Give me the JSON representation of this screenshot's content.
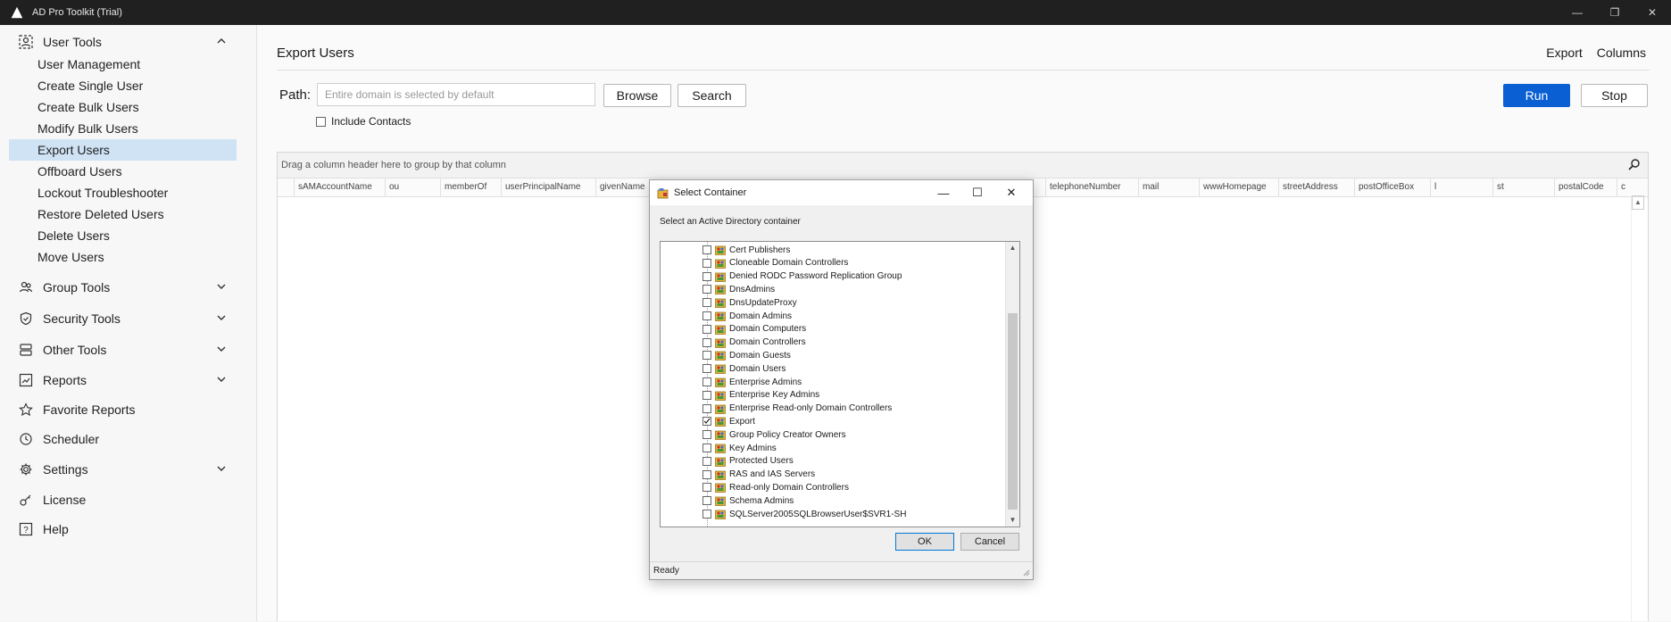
{
  "window": {
    "title": "AD Pro Toolkit (Trial)",
    "controls": [
      "—",
      "❐",
      "✕"
    ]
  },
  "sidebar": {
    "user_tools": {
      "label": "User Tools",
      "items": [
        "User Management",
        "Create Single User",
        "Create Bulk Users",
        "Modify Bulk Users",
        "Export Users",
        "Offboard Users",
        "Lockout Troubleshooter",
        "Restore Deleted Users",
        "Delete Users",
        "Move Users"
      ],
      "selected": "Export Users"
    },
    "group_tools": "Group Tools",
    "security_tools": "Security Tools",
    "other_tools": "Other Tools",
    "reports": "Reports",
    "favorite_reports": "Favorite Reports",
    "scheduler": "Scheduler",
    "settings": "Settings",
    "license": "License",
    "help": "Help"
  },
  "main": {
    "title": "Export Users",
    "export_link": "Export",
    "columns_link": "Columns",
    "path_label": "Path:",
    "path_placeholder": "Entire domain is selected by default",
    "browse": "Browse",
    "search": "Search",
    "run": "Run",
    "stop": "Stop",
    "include_contacts": "Include Contacts",
    "group_hint": "Drag a column header here to group by that column",
    "columns": [
      "sAMAccountName",
      "ou",
      "memberOf",
      "userPrincipalName",
      "givenName",
      "telephoneNumber",
      "mail",
      "wwwHomepage",
      "streetAddress",
      "postOfficeBox",
      "l",
      "st",
      "postalCode",
      "c"
    ]
  },
  "dialog": {
    "title": "Select Container",
    "subtitle": "Select an Active Directory container",
    "items": [
      "Cert Publishers",
      "Cloneable Domain Controllers",
      "Denied RODC Password Replication Group",
      "DnsAdmins",
      "DnsUpdateProxy",
      "Domain Admins",
      "Domain Computers",
      "Domain Controllers",
      "Domain Guests",
      "Domain Users",
      "Enterprise Admins",
      "Enterprise Key Admins",
      "Enterprise Read-only Domain Controllers",
      "Export",
      "Group Policy Creator Owners",
      "Key Admins",
      "Protected Users",
      "RAS and IAS Servers",
      "Read-only Domain Controllers",
      "Schema Admins",
      "SQLServer2005SQLBrowserUser$SVR1-SH"
    ],
    "checked": "Export",
    "ok": "OK",
    "cancel": "Cancel",
    "status": "Ready",
    "controls": [
      "—",
      "☐",
      "✕"
    ]
  },
  "colors": {
    "accent": "#0a5fd3",
    "selected_bg": "#cfe3f5",
    "titlebar": "#202020"
  }
}
